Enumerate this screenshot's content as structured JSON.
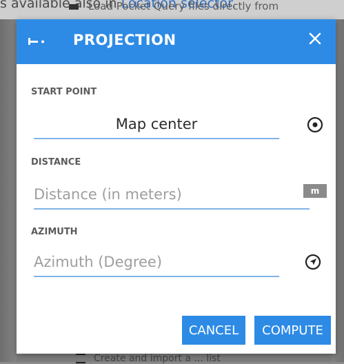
{
  "background": {
    "top_text": "s available also in ",
    "top_link": "Location selector.",
    "behind_text": "Load Pocket Query files directly from",
    "bottom_text": "Create and import a ... list"
  },
  "colors": {
    "accent": "#2d8be6",
    "field_underline": "#7fb3e8",
    "header_text": "#ffffff"
  },
  "dialog": {
    "title": "PROJECTION",
    "header_icon": "projection-icon",
    "close_icon": "close-icon",
    "start_point": {
      "label": "START POINT",
      "value": "Map center",
      "icon": "target-icon"
    },
    "distance": {
      "label": "DISTANCE",
      "placeholder": "Distance (in meters)",
      "unit": "m"
    },
    "azimuth": {
      "label": "AZIMUTH",
      "placeholder": "Azimuth (Degree)",
      "icon": "navigation-icon"
    },
    "buttons": {
      "cancel": "CANCEL",
      "compute": "COMPUTE"
    }
  }
}
